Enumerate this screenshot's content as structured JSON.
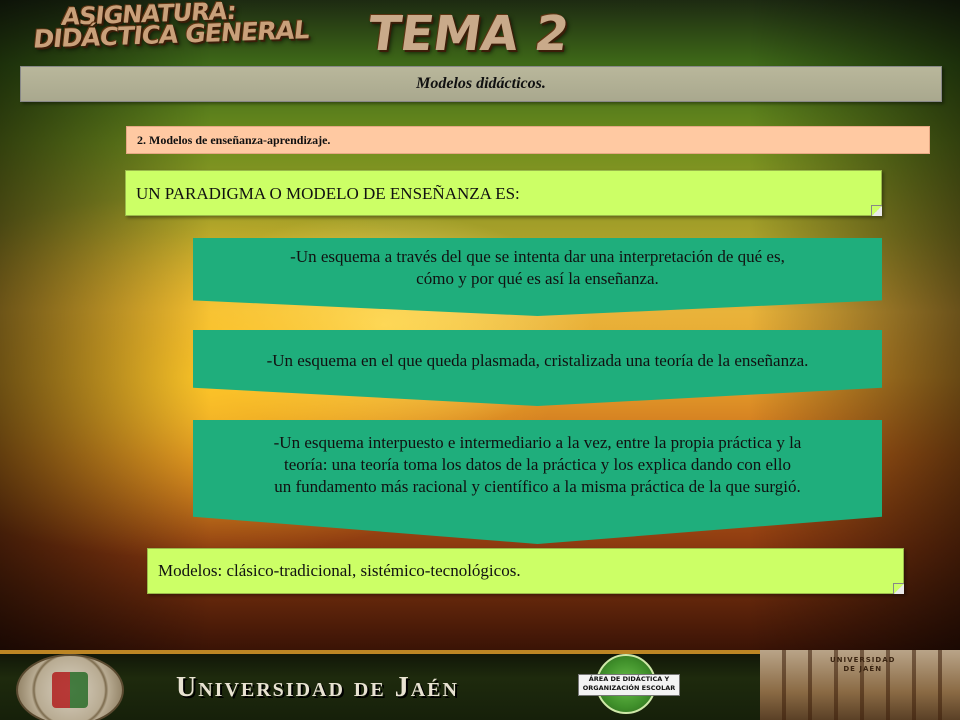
{
  "header": {
    "asignatura_line1": "ASIGNATURA:",
    "asignatura_line2": "DIDÁCTICA GENERAL",
    "tema": "TEMA 2"
  },
  "title_bar": {
    "text": "Modelos didácticos."
  },
  "section_bar": {
    "text": "2. Modelos de enseñanza-aprendizaje."
  },
  "paradigm_box": {
    "text": "UN PARADIGMA O MODELO DE ENSEÑANZA ES:"
  },
  "definitions": [
    {
      "lines": [
        "-Un esquema a través del que se intenta dar una interpretación de qué es,",
        "cómo y por qué es así la enseñanza."
      ]
    },
    {
      "lines": [
        "-Un esquema en el que queda plasmada, cristalizada una teoría de la enseñanza."
      ]
    },
    {
      "lines": [
        "-Un esquema interpuesto e intermediario a la vez, entre la propia práctica y la",
        "teoría: una teoría toma los datos de la práctica y los explica dando con ello",
        "un fundamento más racional y científico a la misma práctica de la que surgió."
      ]
    }
  ],
  "modelos_box": {
    "text": "Modelos: clásico-tradicional, sistémico-tecnológicos."
  },
  "footer": {
    "university": "Universidad de Jaén",
    "department_line1": "ÁREA DE DIDÁCTICA Y",
    "department_line2": "ORGANIZACIÓN ESCOLAR",
    "building_line1": "UNIVERSIDAD",
    "building_line2": "DE JAÉN"
  },
  "colors": {
    "teal_box": "#1fae7c",
    "green_box": "#ccff66",
    "peach_bar": "#ffc9a2",
    "title_bar": "#b9b79b"
  }
}
